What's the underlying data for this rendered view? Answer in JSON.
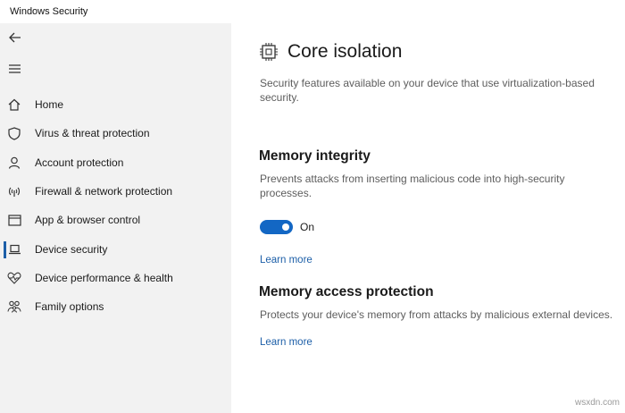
{
  "window": {
    "title": "Windows Security"
  },
  "sidebar": {
    "items": [
      {
        "label": "Home",
        "icon": "home-icon"
      },
      {
        "label": "Virus & threat protection",
        "icon": "shield-icon"
      },
      {
        "label": "Account protection",
        "icon": "person-icon"
      },
      {
        "label": "Firewall & network protection",
        "icon": "wifi-icon"
      },
      {
        "label": "App & browser control",
        "icon": "browser-window-icon"
      },
      {
        "label": "Device security",
        "icon": "laptop-icon",
        "selected": true
      },
      {
        "label": "Device performance & health",
        "icon": "heart-icon"
      },
      {
        "label": "Family options",
        "icon": "family-icon"
      }
    ]
  },
  "main": {
    "title": "Core isolation",
    "description": "Security features available on your device that use virtualization-based security.",
    "memory_integrity": {
      "heading": "Memory integrity",
      "description": "Prevents attacks from inserting malicious code into high-security processes.",
      "toggle_state": "On",
      "learn_more": "Learn more"
    },
    "memory_access": {
      "heading": "Memory access protection",
      "description": "Protects your device's memory from attacks by malicious external devices.",
      "learn_more": "Learn more"
    }
  },
  "watermark": "wsxdn.com",
  "colors": {
    "accent": "#1367c4",
    "link": "#1d5fa8",
    "sidebar_bg": "#f2f2f2"
  }
}
